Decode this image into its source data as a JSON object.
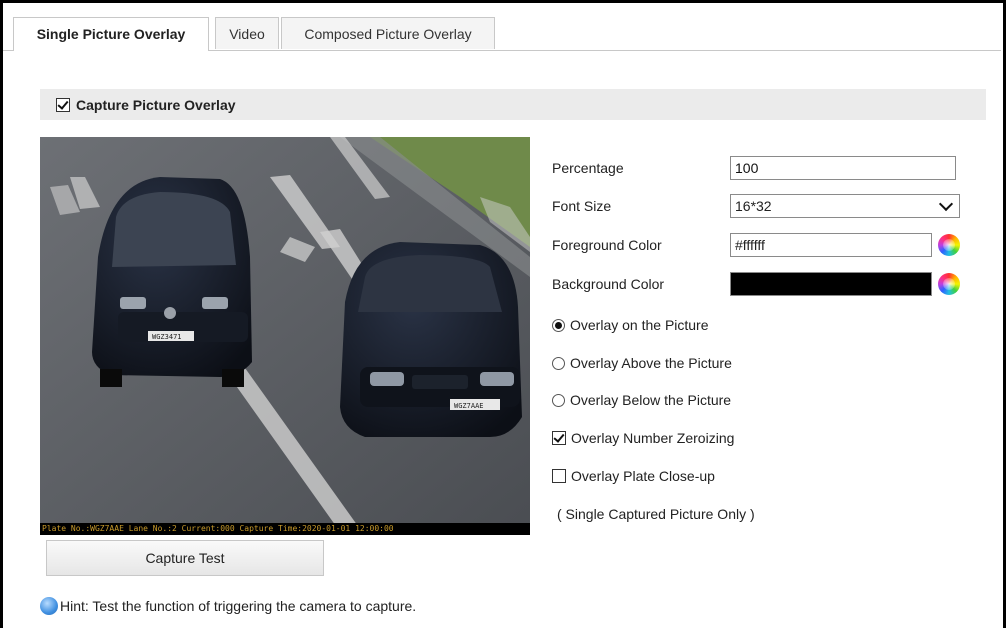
{
  "tabs": [
    {
      "label": "Single Picture Overlay",
      "active": true
    },
    {
      "label": "Video",
      "active": false
    },
    {
      "label": "Composed Picture Overlay",
      "active": false
    }
  ],
  "section": {
    "title": "Capture Picture Overlay",
    "checked": true
  },
  "preview": {
    "overlay_text": "Plate No.:WGZ7AAE Lane No.:2 Current:000 Capture Time:2020-01-01 12:00:00",
    "plate_left": "WGZ3471",
    "plate_right": "WGZ7AAE"
  },
  "capture_button": {
    "label": "Capture Test"
  },
  "hint": {
    "text": "Hint: Test the function of triggering the camera to capture."
  },
  "form": {
    "percentage": {
      "label": "Percentage",
      "value": "100"
    },
    "font_size": {
      "label": "Font Size",
      "value": "16*32"
    },
    "foreground_color": {
      "label": "Foreground Color",
      "value": "#ffffff"
    },
    "background_color": {
      "label": "Background Color",
      "value": "#000000"
    },
    "overlay_options": [
      {
        "label": "Overlay on the Picture",
        "selected": true
      },
      {
        "label": "Overlay Above the Picture",
        "selected": false
      },
      {
        "label": "Overlay Below the Picture",
        "selected": false
      }
    ],
    "zeroizing": {
      "label": "Overlay Number Zeroizing",
      "checked": true
    },
    "plate_closeup": {
      "label": "Overlay Plate Close-up",
      "checked": false
    },
    "note": "( Single Captured Picture Only )"
  },
  "colors": {
    "accent_border": "#8a8a8a",
    "header_bg": "#ebebeb"
  },
  "icons": {
    "hint": "info-icon",
    "color_picker": "color-wheel-icon"
  }
}
